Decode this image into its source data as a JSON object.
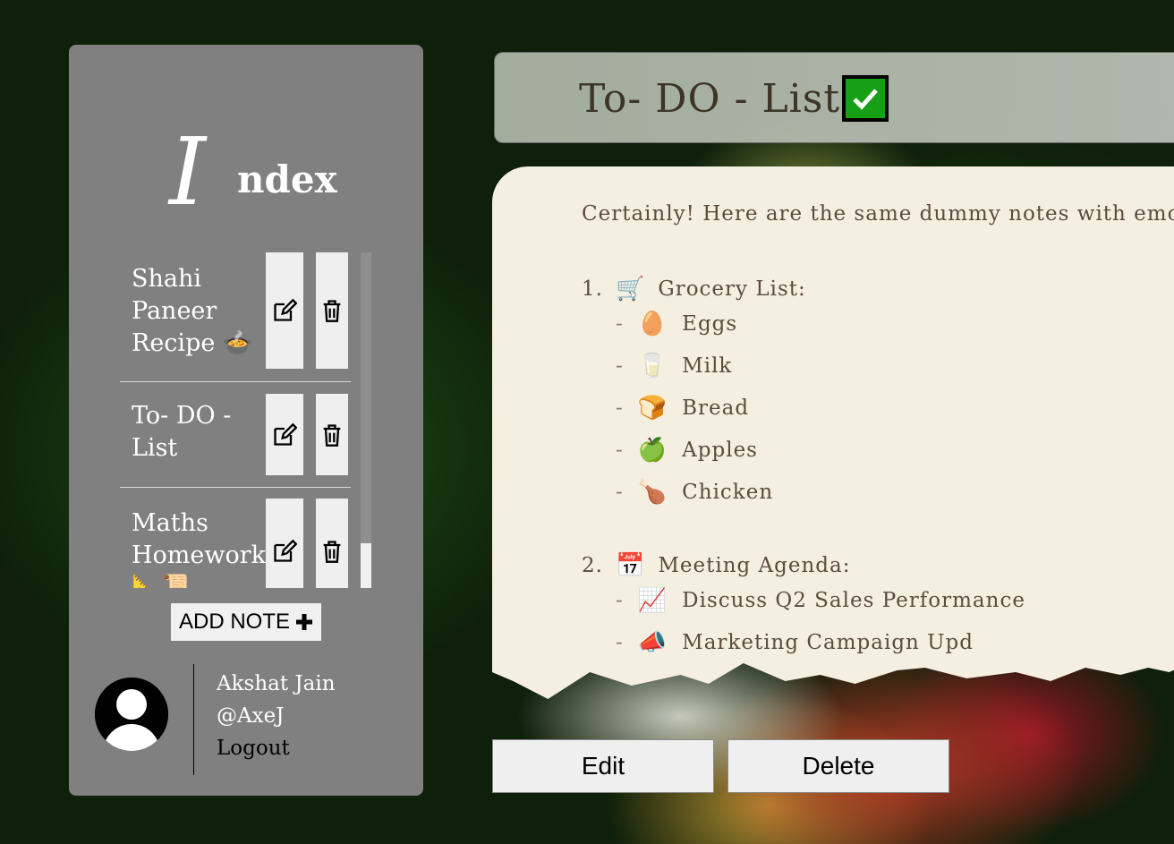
{
  "sidebar": {
    "title_initial": "I",
    "title_rest": "ndex",
    "notes": [
      {
        "label_line1": "Shahi",
        "label_line2": "Paneer",
        "label_line3": "Recipe",
        "emoji": "🍲"
      },
      {
        "label_line1": "To- DO -",
        "label_line2": "List"
      },
      {
        "label_line1": "Maths",
        "label_line2": "Homework",
        "label_line3": "📐📜"
      }
    ],
    "add_note_label": "ADD NOTE",
    "user": {
      "name": "Akshat Jain",
      "handle": "@AxeJ",
      "logout": "Logout"
    }
  },
  "note": {
    "title": "To- DO - List",
    "intro": "Certainly! Here are the same dummy notes with emoji",
    "sections": [
      {
        "number": "1.",
        "emoji": "🛒",
        "title": "Grocery List:",
        "items": [
          {
            "emoji": "🥚",
            "text": "Eggs"
          },
          {
            "emoji": "🥛",
            "text": "Milk"
          },
          {
            "emoji": "🍞",
            "text": "Bread"
          },
          {
            "emoji": "🍏",
            "text": "Apples"
          },
          {
            "emoji": "🍗",
            "text": "Chicken"
          }
        ]
      },
      {
        "number": "2.",
        "emoji": "📅",
        "title": "Meeting Agenda:",
        "items": [
          {
            "emoji": "📈",
            "text": "Discuss Q2 Sales Performance"
          },
          {
            "emoji": "📣",
            "text": "Marketing Campaign Upd"
          }
        ]
      }
    ]
  },
  "actions": {
    "edit_label": "Edit",
    "delete_label": "Delete"
  }
}
